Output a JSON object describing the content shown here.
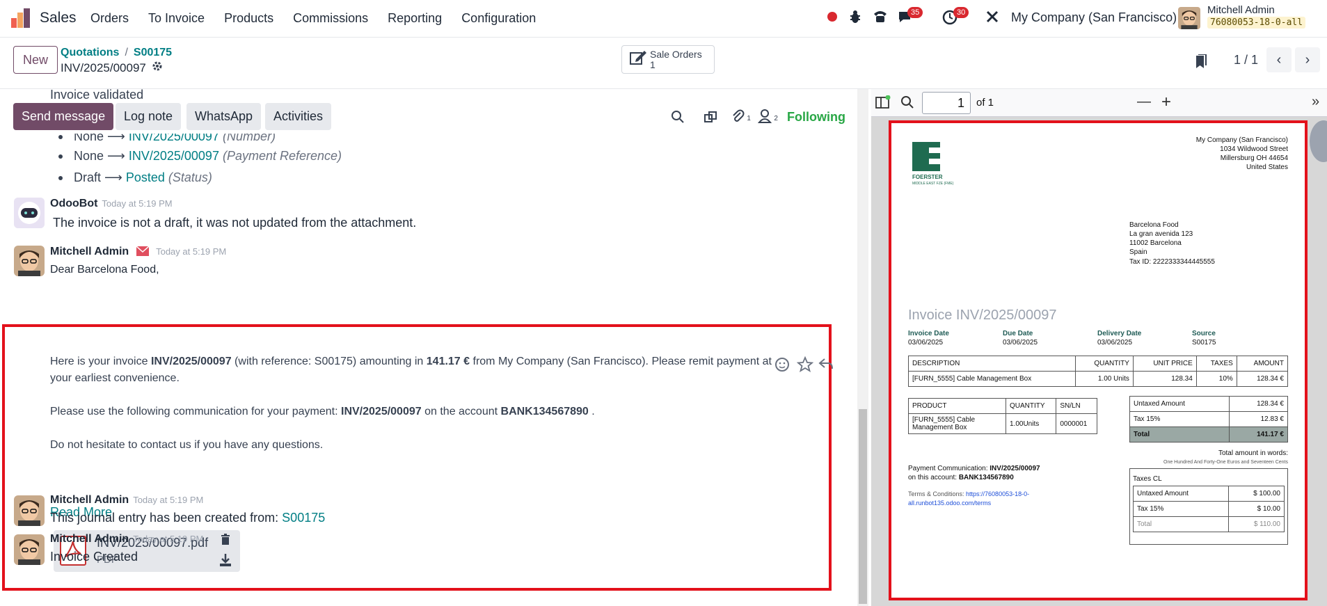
{
  "navbar": {
    "app_name": "Sales",
    "menu": [
      "Orders",
      "To Invoice",
      "Products",
      "Commissions",
      "Reporting",
      "Configuration"
    ],
    "messages_count": "35",
    "activities_count": "30",
    "company": "My Company (San Francisco)",
    "user_name": "Mitchell Admin",
    "db_name": "76080053-18-0-all"
  },
  "control": {
    "new_label": "New",
    "breadcrumb_parent": "Quotations",
    "breadcrumb_sep": "/",
    "breadcrumb_current": "S00175",
    "record_title": "INV/2025/00097",
    "smart_button_label": "Sale Orders",
    "smart_button_count": "1",
    "pager": "1 / 1"
  },
  "chatter": {
    "top_cut_text": "Invoice validated",
    "buttons": {
      "send_message": "Send message",
      "log_note": "Log note",
      "whatsapp": "WhatsApp",
      "activities": "Activities"
    },
    "attachments_count": "1",
    "followers_count": "2",
    "following_label": "Following",
    "tracking": [
      {
        "old": "None",
        "new": "INV/2025/00097",
        "field": "(Number)"
      },
      {
        "old": "None",
        "new": "INV/2025/00097",
        "field": "(Payment Reference)"
      },
      {
        "old": "Draft",
        "new": "Posted",
        "field": "(Status)"
      }
    ],
    "bot_msg": {
      "author": "OdooBot",
      "time": "Today at 5:19 PM",
      "body": "The invoice is not a draft, it was not updated from the attachment."
    },
    "mail_msg": {
      "author": "Mitchell Admin",
      "time": "Today at 5:19 PM",
      "greeting": "Dear Barcelona Food,",
      "p1_a": "Here is your invoice ",
      "p1_inv": "INV/2025/00097",
      "p1_b": " (with reference: S00175) amounting in ",
      "p1_amount": "141.17 €",
      "p1_c": " from My Company (San Francisco). Please remit payment at your earliest convenience.",
      "p2_a": "Please use the following communication for your payment: ",
      "p2_inv": "INV/2025/00097",
      "p2_b": " on the account ",
      "p2_acc": "BANK134567890",
      "p2_c": " .",
      "p3": "Do not hesitate to contact us if you have any questions.",
      "read_more": "Read More",
      "attachment_name": "INV/2025/00097.pdf",
      "attachment_type": "PDF"
    },
    "journal_msg": {
      "author": "Mitchell Admin",
      "time": "Today at 5:19 PM",
      "body_prefix": "This journal entry has been created from: ",
      "body_link": "S00175"
    },
    "created_msg": {
      "author": "Mitchell Admin",
      "time": "Today at 5:19 PM",
      "body": "Invoice Created"
    }
  },
  "pdf": {
    "page_value": "1",
    "page_of": "of 1",
    "logo_text": "FOERSTER",
    "logo_sub": "MIDDLE EAST FZE (FME)",
    "company_lines": [
      "My Company (San Francisco)",
      "1034 Wildwood Street",
      "Millersburg OH 44654",
      "United States"
    ],
    "customer_lines": [
      "Barcelona Food",
      "La gran avenida 123",
      "11002 Barcelona",
      "Spain"
    ],
    "tax_id": "Tax ID: 2222333344445555",
    "title": "Invoice INV/2025/00097",
    "meta": [
      {
        "label": "Invoice Date",
        "value": "03/06/2025"
      },
      {
        "label": "Due Date",
        "value": "03/06/2025"
      },
      {
        "label": "Delivery Date",
        "value": "03/06/2025"
      },
      {
        "label": "Source",
        "value": "S00175"
      }
    ],
    "lines_header": [
      "DESCRIPTION",
      "QUANTITY",
      "UNIT PRICE",
      "TAXES",
      "AMOUNT"
    ],
    "lines": [
      [
        "[FURN_5555] Cable Management Box",
        "1.00 Units",
        "128.34",
        "10%",
        "128.34 €"
      ]
    ],
    "sn_header": [
      "PRODUCT",
      "QUANTITY",
      "SN/LN"
    ],
    "sn_row": [
      "[FURN_5555] Cable Management Box",
      "1.00Units",
      "0000001"
    ],
    "totals": [
      {
        "label": "Untaxed Amount",
        "value": "128.34 €"
      },
      {
        "label": "Tax 15%",
        "value": "12.83 €"
      },
      {
        "label": "Total",
        "value": "141.17 €"
      }
    ],
    "total_words_label": "Total amount in words:",
    "total_words": "One Hundred And Forty-One Euros and Seventeen Cents",
    "payment_comm_label": "Payment Communication: ",
    "payment_comm_value": "INV/2025/00097",
    "account_label": "on this account: ",
    "account_value": "BANK134567890",
    "terms_label": "Terms & Conditions: ",
    "terms_link_1": "https://76080053-18-0-",
    "terms_link_2": "all.runbot135.odoo.com/terms",
    "taxes_cl_title": "Taxes CL",
    "taxes_cl": [
      {
        "label": "Untaxed Amount",
        "value": "$ 100.00"
      },
      {
        "label": "Tax 15%",
        "value": "$ 10.00"
      },
      {
        "label": "Total",
        "value": "$ 110.00"
      }
    ]
  },
  "colors": {
    "brand": "#714b67",
    "link": "#017e84",
    "highlight": "#e3111b",
    "following": "#28a745"
  }
}
